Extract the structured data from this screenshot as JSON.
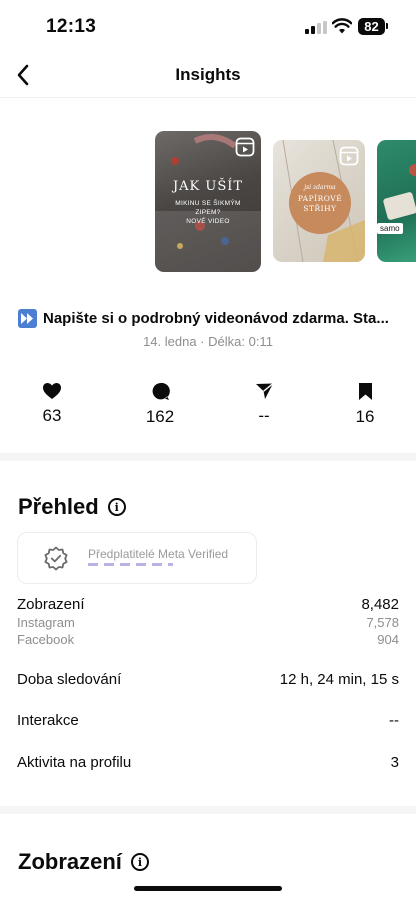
{
  "status": {
    "time": "12:13",
    "battery": "82"
  },
  "nav": {
    "title": "Insights",
    "back_icon": "chevron-left-icon"
  },
  "thumbnails": [
    {
      "title": "JAK UŠÍT",
      "subtitle_lines": [
        "MIKINU SE ŠIKMÝM",
        "ZIPEM?",
        "NOVÉ VIDEO"
      ],
      "icon": "reel-icon"
    },
    {
      "small": "jsi zdarma",
      "title_lines": [
        "PAPÍROVÉ",
        "STŘIHY"
      ],
      "icon": "reel-icon"
    },
    {
      "tag": "samo"
    }
  ],
  "post": {
    "caption": "Napište si o podrobný videonávod zdarma. Sta...",
    "meta": "14. ledna · Délka: 0:11"
  },
  "stats": [
    {
      "icon": "heart-icon",
      "value": "63"
    },
    {
      "icon": "comment-icon",
      "value": "162"
    },
    {
      "icon": "share-icon",
      "value": "--"
    },
    {
      "icon": "bookmark-icon",
      "value": "16"
    }
  ],
  "overview": {
    "title": "Přehled",
    "verified_text": "Předplatitelé Meta Verified",
    "rows": [
      {
        "label": "Zobrazení",
        "value": "8,482"
      },
      {
        "label": "Instagram",
        "value": "7,578"
      },
      {
        "label": "Facebook",
        "value": "904"
      },
      {
        "label": "Doba sledování",
        "value": "12 h, 24 min, 15 s"
      },
      {
        "label": "Interakce",
        "value": "--"
      },
      {
        "label": "Aktivita na profilu",
        "value": "3"
      }
    ]
  },
  "views_section": {
    "title": "Zobrazení"
  },
  "colors": {
    "accent": "#4c7fd1",
    "thumb_badge": "#c68a5d",
    "muted": "#8e8e8e"
  }
}
